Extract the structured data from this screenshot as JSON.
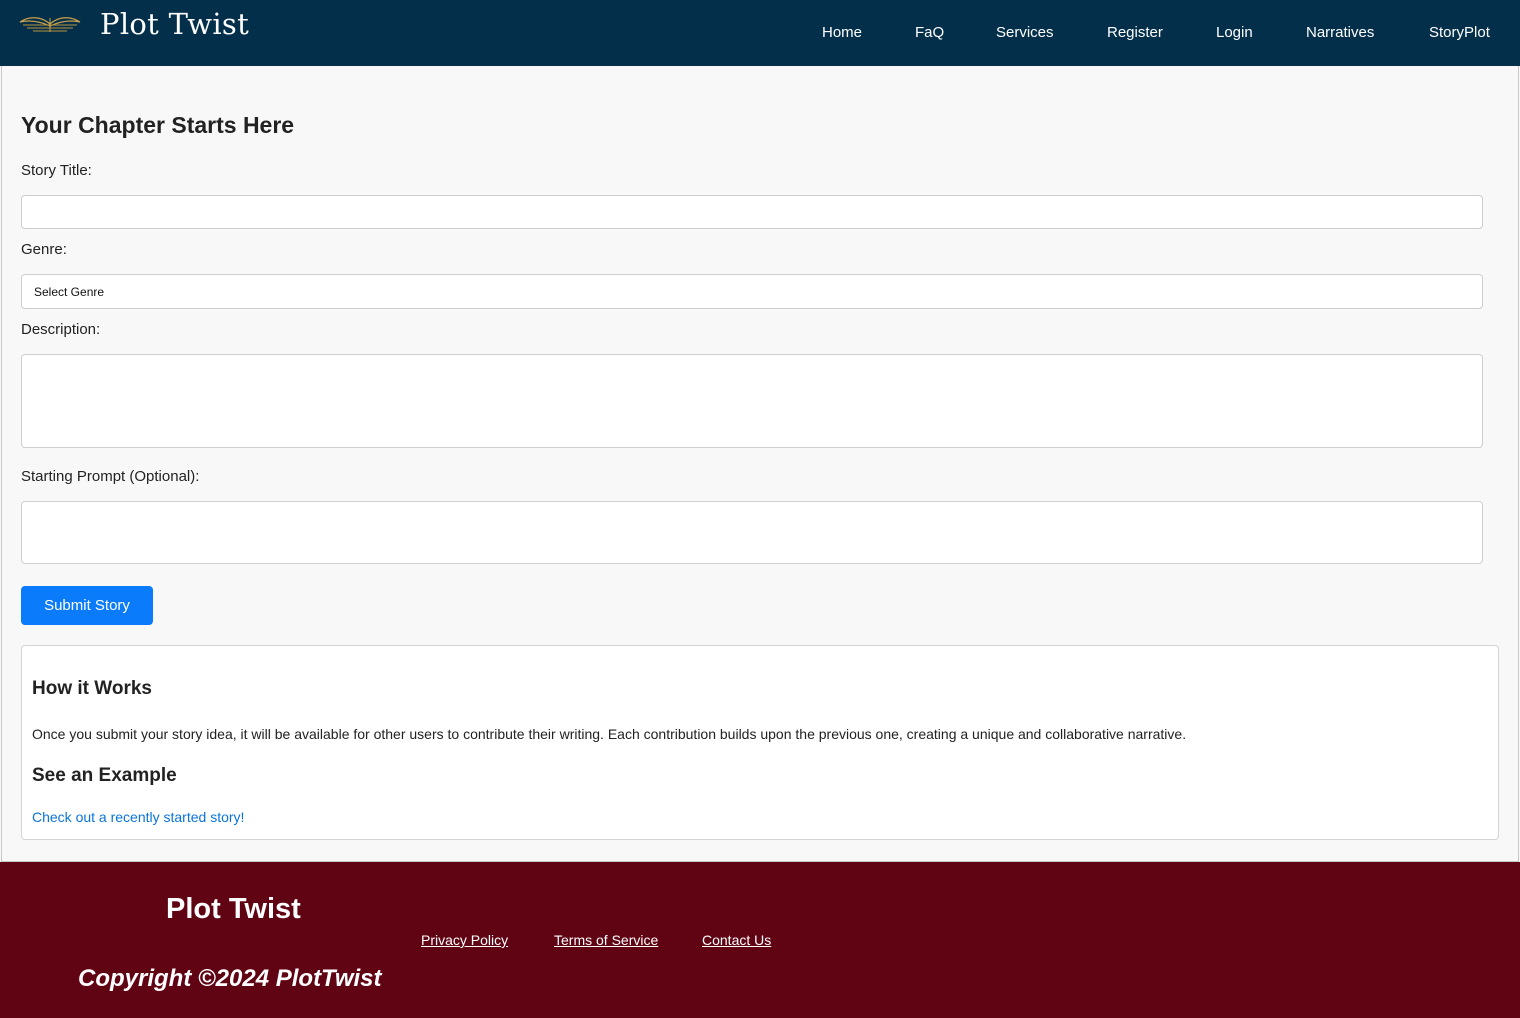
{
  "header": {
    "brand": "Plot Twist",
    "logo_icon": "winged-book-icon",
    "nav": [
      "Home",
      "FaQ",
      "Services",
      "Register",
      "Login",
      "Narratives",
      "StoryPlot"
    ]
  },
  "form": {
    "title": "Your Chapter Starts Here",
    "story_title_label": "Story Title:",
    "story_title_value": "",
    "genre_label": "Genre:",
    "genre_selected": "Select Genre",
    "description_label": "Description:",
    "description_value": "",
    "prompt_label": "Starting Prompt (Optional):",
    "prompt_value": "",
    "submit_label": "Submit Story"
  },
  "info": {
    "how_title": "How it Works",
    "how_text": "Once you submit your story idea, it will be available for other users to contribute their writing. Each contribution builds upon the previous one, creating a unique and collaborative narrative.",
    "example_title": "See an Example",
    "example_link": "Check out a recently started story!"
  },
  "footer": {
    "brand": "Plot Twist",
    "links": [
      "Privacy Policy",
      "Terms of Service",
      "Contact Us"
    ],
    "copyright": "Copyright ©2024 PlotTwist"
  },
  "colors": {
    "header_bg": "#032f4b",
    "footer_bg": "#600414",
    "button_bg": "#0a7bfa",
    "link": "#0a74d9"
  }
}
